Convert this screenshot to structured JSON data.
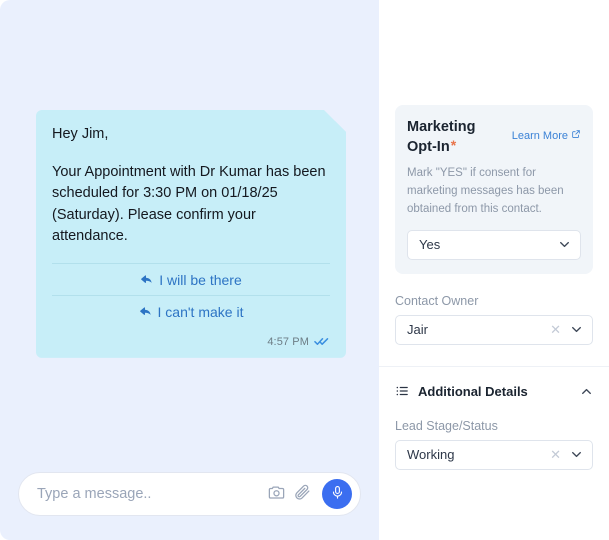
{
  "chat": {
    "message": {
      "greeting": "Hey Jim,",
      "body": "Your Appointment with Dr Kumar has been scheduled for 3:30 PM on 01/18/25 (Saturday). Please confirm your attendance.",
      "time": "4:57 PM",
      "status_icon": "double-check-icon",
      "quick_replies": [
        {
          "label": "I will be there",
          "icon": "reply-arrow-icon"
        },
        {
          "label": "I can't make it",
          "icon": "reply-arrow-icon"
        }
      ]
    },
    "composer": {
      "placeholder": "Type a message..",
      "value": "",
      "camera_icon": "camera-icon",
      "attach_icon": "paperclip-icon",
      "mic_icon": "microphone-icon"
    },
    "colors": {
      "pane_background": "#eaf0fd",
      "bubble_background": "#c7eef8",
      "link": "#2d74c4",
      "mic_button": "#3b6ef0"
    }
  },
  "details": {
    "optin_card": {
      "title": "Marketing Opt-In",
      "required_marker": "*",
      "learn_more_label": "Learn More",
      "learn_more_icon": "external-link-icon",
      "help_text": "Mark \"YES\" if consent for marketing messages has been obtained from this contact.",
      "select": {
        "value": "Yes",
        "chevron_icon": "chevron-down-icon"
      }
    },
    "contact_owner": {
      "label": "Contact Owner",
      "value": "Jair",
      "clear_icon": "close-icon",
      "chevron_icon": "chevron-down-icon"
    },
    "additional_details": {
      "section_icon": "list-icon",
      "title": "Additional Details",
      "toggle_icon": "chevron-up-icon",
      "lead_stage": {
        "label": "Lead Stage/Status",
        "value": "Working",
        "clear_icon": "close-icon",
        "chevron_icon": "chevron-down-icon"
      }
    },
    "colors": {
      "card_background": "#f1f5f9",
      "required": "#e8734a",
      "link": "#3b82d6"
    }
  }
}
